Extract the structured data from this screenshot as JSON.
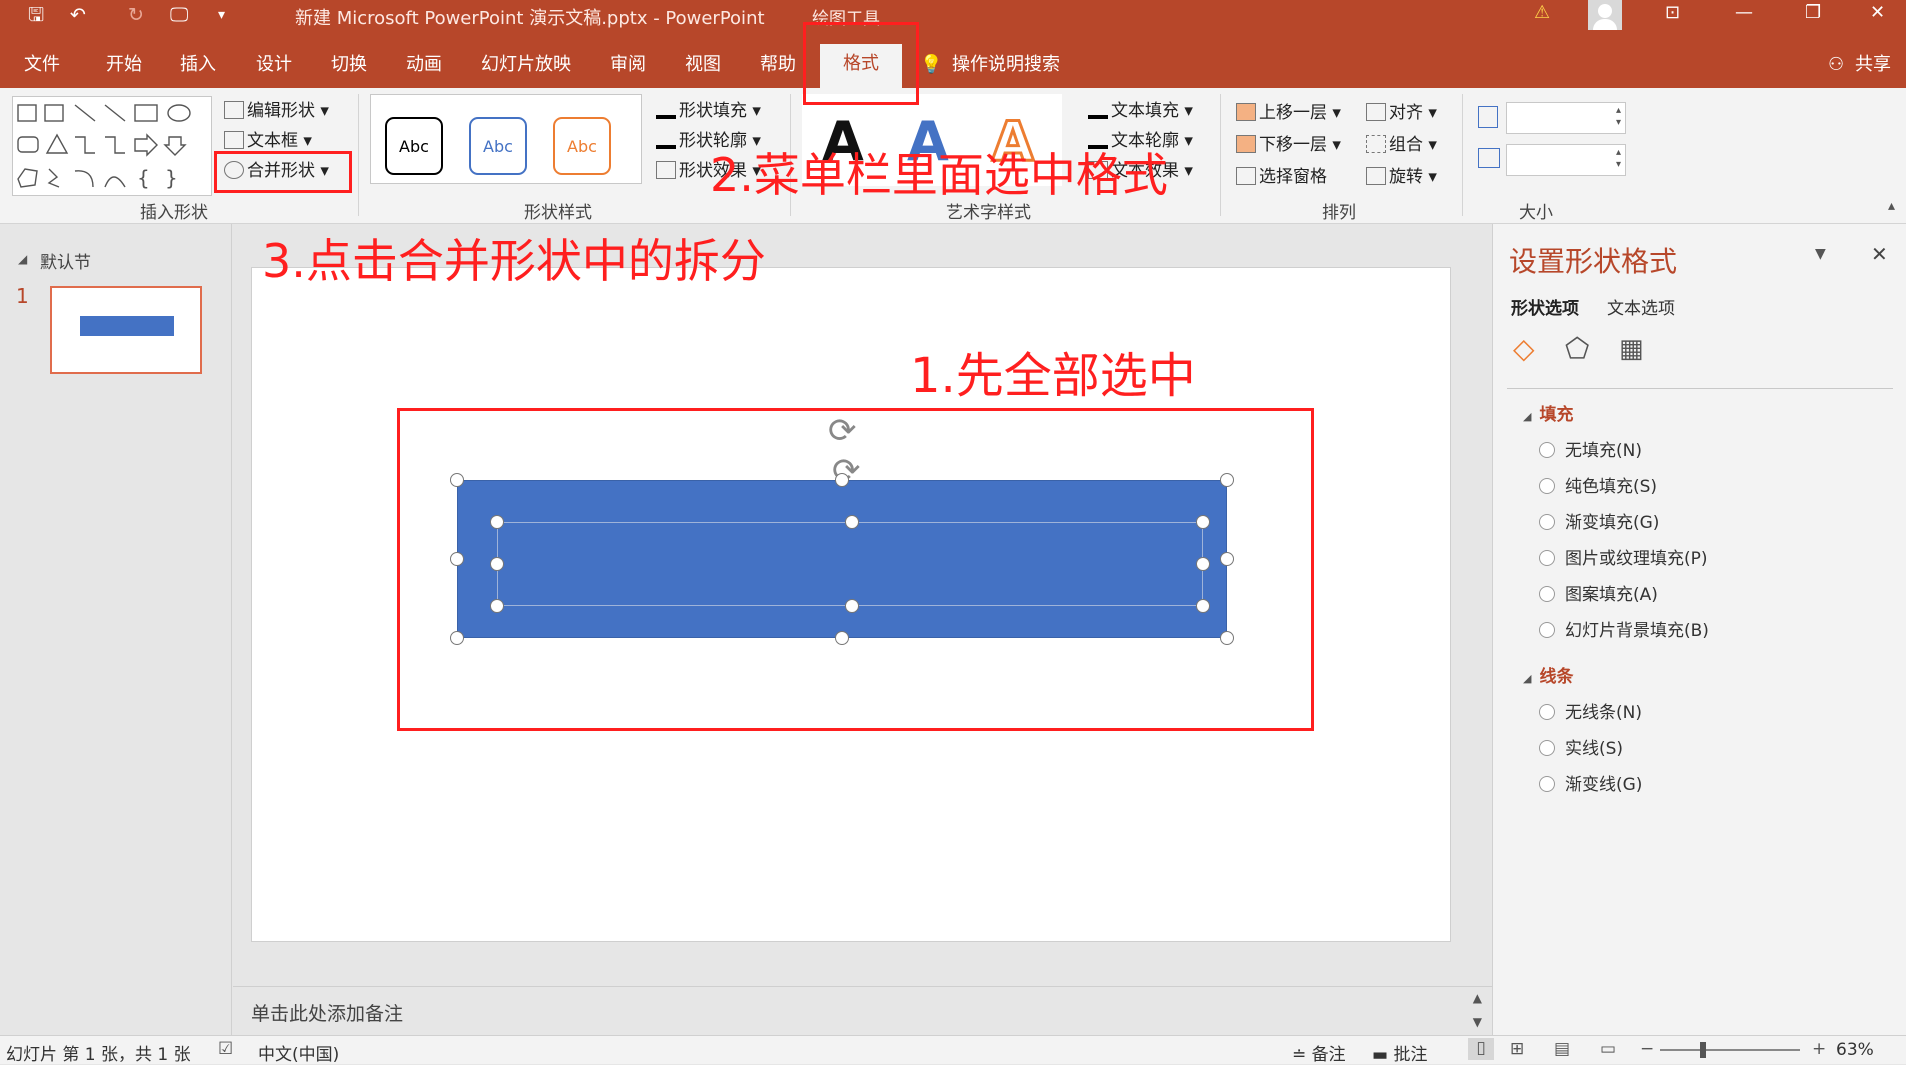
{
  "titlebar": {
    "doc_title": "新建 Microsoft PowerPoint 演示文稿.pptx  -  PowerPoint",
    "context_tools": "绘图工具",
    "qa_save": "🖫",
    "qa_undo": "↶",
    "qa_redo": "↻",
    "qa_present": "🖵",
    "qa_more": "▾",
    "warn": "⚠",
    "btn_ribbon": "⊡",
    "btn_min": "—",
    "btn_restore": "❐",
    "btn_close": "✕"
  },
  "tabs": [
    "文件",
    "开始",
    "插入",
    "设计",
    "切换",
    "动画",
    "幻灯片放映",
    "审阅",
    "视图",
    "帮助"
  ],
  "active_tab": "格式",
  "tell_me": "操作说明搜索",
  "share": "共享",
  "ribbon": {
    "insert_shapes": {
      "edit_shape": "编辑形状",
      "textbox": "文本框",
      "merge_shapes": "合并形状",
      "label": "插入形状"
    },
    "shape_styles": {
      "abc": [
        "Abc",
        "Abc",
        "Abc"
      ],
      "fill": "形状填充",
      "outline": "形状轮廓",
      "effects": "形状效果",
      "label": "形状样式"
    },
    "wordart": {
      "text_fill": "文本填充",
      "text_outline": "文本轮廓",
      "text_effects": "文本效果",
      "letter": "A",
      "label": "艺术字样式"
    },
    "arrange": {
      "bring_forward": "上移一层",
      "send_backward": "下移一层",
      "selection_pane": "选择窗格",
      "align": "对齐",
      "group": "组合",
      "rotate": "旋转",
      "label": "排列"
    },
    "size": {
      "label": "大小"
    }
  },
  "left_pane": {
    "section": "默认节",
    "slide_number": "1"
  },
  "notes_placeholder": "单击此处添加备注",
  "format_pane": {
    "title": "设置形状格式",
    "tab_shape": "形状选项",
    "tab_text": "文本选项",
    "fill_section": "填充",
    "fill_options": [
      "无填充(N)",
      "纯色填充(S)",
      "渐变填充(G)",
      "图片或纹理填充(P)",
      "图案填充(A)",
      "幻灯片背景填充(B)"
    ],
    "line_section": "线条",
    "line_options": [
      "无线条(N)",
      "实线(S)",
      "渐变线(G)"
    ]
  },
  "statusbar": {
    "slide_info": "幻灯片 第 1 张，共 1 张",
    "language": "中文(中国)",
    "notes": "备注",
    "comments": "批注",
    "zoom": "63%",
    "minus": "−",
    "plus": "+"
  },
  "annotations": {
    "step1": "1.先全部选中",
    "step2": "2.菜单栏里面选中格式",
    "step3": "3.点击合并形状中的拆分"
  },
  "colors": {
    "accent": "#b7472a",
    "shape_fill": "#4472c4",
    "annotation": "#ff1f1f"
  }
}
